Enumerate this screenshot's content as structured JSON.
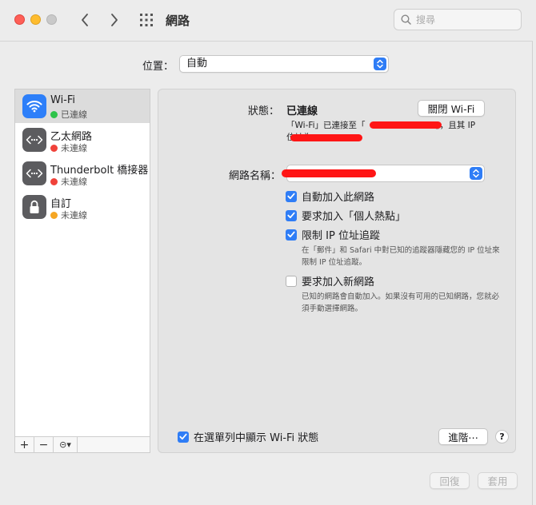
{
  "window": {
    "title": "網路",
    "search_placeholder": "搜尋"
  },
  "location": {
    "label": "位置：",
    "value": "自動"
  },
  "services": [
    {
      "name": "Wi-Fi",
      "status": "已連線",
      "status_color": "#2ec34a",
      "icon": "wifi-icon"
    },
    {
      "name": "乙太網路",
      "status": "未連線",
      "status_color": "#f0423a",
      "icon": "ethernet-icon"
    },
    {
      "name": "Thunderbolt 橋接器",
      "status": "未連線",
      "status_color": "#f0423a",
      "icon": "ethernet-icon"
    },
    {
      "name": "自訂",
      "status": "未連線",
      "status_color": "#f5a623",
      "icon": "lock-icon"
    }
  ],
  "sidebar_toolbar": {
    "add": "+",
    "remove": "−",
    "action": "⊝▾"
  },
  "detail": {
    "status_label": "狀態：",
    "status_value": "已連線",
    "toggle_wifi_label": "關閉 Wi-Fi",
    "status_desc_prefix": "「Wi-Fi」已連接至「",
    "status_desc_mid": "」，且其 IP",
    "status_desc_line2": "位址為",
    "network_name_label": "網路名稱：",
    "auto_join_label": "自動加入此網路",
    "hotspot_label": "要求加入「個人熱點」",
    "limit_ip_label": "限制 IP 位址追蹤",
    "limit_ip_hint": "在「郵件」和 Safari 中對已知的追蹤器隱藏您的 IP 位址來限制 IP 位址追蹤。",
    "ask_new_label": "要求加入新網路",
    "ask_new_hint": "已知的網路會自動加入。如果沒有可用的已知網路，您就必須手動選擇網路。",
    "show_menu_label": "在選單列中顯示 Wi-Fi 狀態",
    "advanced_label": "進階⋯",
    "help_label": "?"
  },
  "footer": {
    "revert_label": "回復",
    "apply_label": "套用"
  },
  "colors": {
    "accent": "#2f7df6",
    "redaction": "#ff1515"
  }
}
